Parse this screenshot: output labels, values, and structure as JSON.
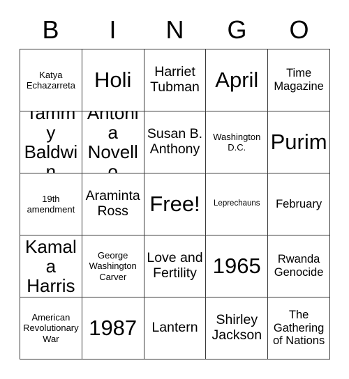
{
  "header": {
    "letters": [
      "B",
      "I",
      "N",
      "G",
      "O"
    ]
  },
  "grid": {
    "columns": 5,
    "rows": 5,
    "cells": [
      {
        "text": "Katya Echazarreta",
        "size": "fs-sm"
      },
      {
        "text": "Holi",
        "size": "fs-xxl"
      },
      {
        "text": "Harriet Tubman",
        "size": "fs-lg"
      },
      {
        "text": "April",
        "size": "fs-xxl"
      },
      {
        "text": "Time Magazine",
        "size": "fs-md"
      },
      {
        "text": "Tammy Baldwin",
        "size": "fs-xl"
      },
      {
        "text": "Antonia Novello",
        "size": "fs-xl"
      },
      {
        "text": "Susan B. Anthony",
        "size": "fs-lg"
      },
      {
        "text": "Washington D.C.",
        "size": "fs-sm"
      },
      {
        "text": "Purim",
        "size": "fs-xxl"
      },
      {
        "text": "19th amendment",
        "size": "fs-sm"
      },
      {
        "text": "Araminta Ross",
        "size": "fs-lg"
      },
      {
        "text": "Free!",
        "size": "fs-xxl"
      },
      {
        "text": "Leprechauns",
        "size": "fs-xs"
      },
      {
        "text": "February",
        "size": "fs-md"
      },
      {
        "text": "Kamala Harris",
        "size": "fs-xl"
      },
      {
        "text": "George Washington Carver",
        "size": "fs-sm"
      },
      {
        "text": "Love and Fertility",
        "size": "fs-lg"
      },
      {
        "text": "1965",
        "size": "fs-xxl"
      },
      {
        "text": "Rwanda Genocide",
        "size": "fs-md"
      },
      {
        "text": "American Revolutionary War",
        "size": "fs-sm"
      },
      {
        "text": "1987",
        "size": "fs-xxl"
      },
      {
        "text": "Lantern",
        "size": "fs-lg"
      },
      {
        "text": "Shirley Jackson",
        "size": "fs-lg"
      },
      {
        "text": "The Gathering of Nations",
        "size": "fs-md"
      }
    ]
  },
  "colors": {
    "background": "#ffffff",
    "text": "#000000",
    "border": "#3a3a3a"
  }
}
